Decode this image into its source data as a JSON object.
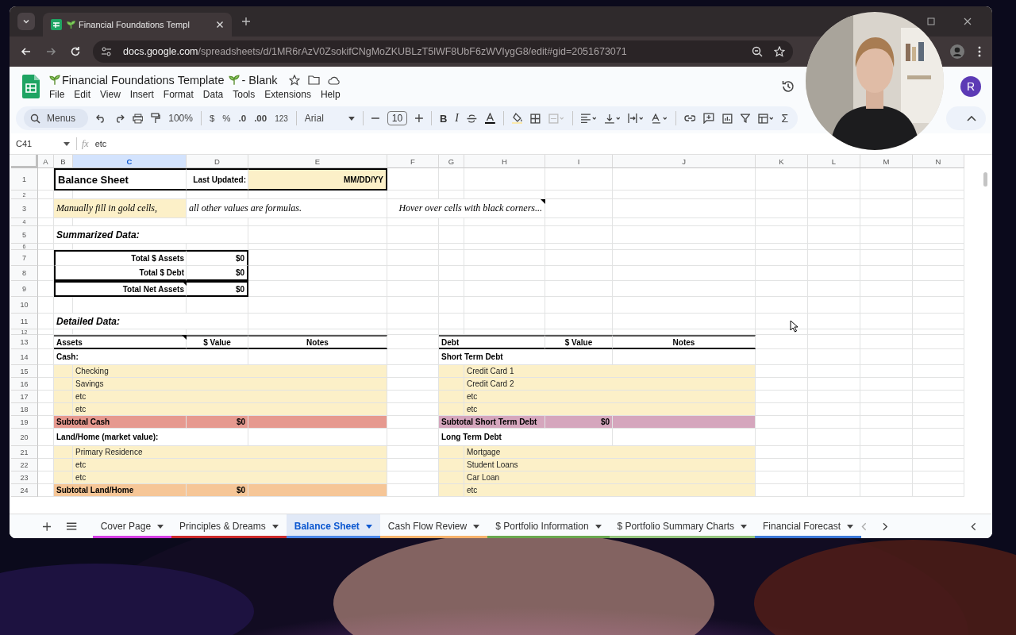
{
  "browser": {
    "tab_title": "Financial Foundations Templ",
    "url_host": "docs.google.com",
    "url_path": "/spreadsheets/d/1MR6rAzV0ZsokifCNgMoZKUBLzT5lWF8UbF6zWVIygG8/edit#gid=2051673071"
  },
  "doc": {
    "title": "Financial Foundations Template",
    "suffix": "- Blank",
    "menus": [
      "File",
      "Edit",
      "View",
      "Insert",
      "Format",
      "Data",
      "Tools",
      "Extensions",
      "Help"
    ],
    "avatar": "R"
  },
  "toolbar": {
    "search": "Menus",
    "zoom": "100%",
    "currency": "$",
    "percent": "%",
    "dec_less": ".0",
    "dec_more": ".00",
    "number_format": "123",
    "font": "Arial",
    "font_size": "10",
    "bold": "B",
    "italic": "I",
    "sum": "Σ"
  },
  "formula_bar": {
    "cell": "C41",
    "fx": "fx",
    "value": "etc"
  },
  "sheet": {
    "columns": [
      {
        "label": "A",
        "selected": false
      },
      {
        "label": "B",
        "selected": false
      },
      {
        "label": "C",
        "selected": true
      },
      {
        "label": "D",
        "selected": false
      },
      {
        "label": "E",
        "selected": false
      },
      {
        "label": "F",
        "selected": false
      },
      {
        "label": "G",
        "selected": false
      },
      {
        "label": "H",
        "selected": false
      },
      {
        "label": "I",
        "selected": false
      },
      {
        "label": "J",
        "selected": false
      },
      {
        "label": "K",
        "selected": false
      },
      {
        "label": "L",
        "selected": false
      },
      {
        "label": "M",
        "selected": false
      },
      {
        "label": "N",
        "selected": false
      }
    ],
    "rows": [
      {
        "number": "1",
        "kind": "boxed",
        "cells": [
          "",
          {
            "text": "Balance Sheet",
            "kind": "title"
          },
          "",
          {
            "text": "Last Updated:",
            "kind": "label"
          },
          {
            "text": "MM/DD/YY",
            "kind": "amount",
            "color": "#fcf0c8"
          }
        ]
      },
      {
        "number": "2",
        "cells": []
      },
      {
        "number": "3",
        "cells": [
          "",
          {
            "text": "Manually fill in gold cells,",
            "kind": "script",
            "color": "#fcf0c8"
          },
          {
            "color": "#fcf0c8"
          },
          {
            "text": "all other values are formulas.",
            "kind": "script"
          },
          "",
          "",
          "",
          {
            "text": "Hover over cells with black corners...",
            "kind": "hint",
            "note": true
          }
        ]
      },
      {
        "number": "4",
        "cells": []
      },
      {
        "number": "5",
        "cells": [
          "",
          {
            "text": "Summarized Data:",
            "kind": "heading"
          }
        ]
      },
      {
        "number": "6",
        "cells": []
      },
      {
        "number": "7",
        "kind": "boxtop",
        "cells": [
          "",
          "",
          {
            "text": "Total $ Assets",
            "kind": "label"
          },
          {
            "text": "$0",
            "kind": "amount"
          }
        ]
      },
      {
        "number": "8",
        "kind": "boxbottom",
        "cells": [
          "",
          "",
          {
            "text": "Total $ Debt",
            "kind": "label"
          },
          {
            "text": "$0",
            "kind": "amount"
          }
        ]
      },
      {
        "number": "9",
        "kind": "boxed",
        "cells": [
          "",
          "",
          {
            "text": "Total Net Assets",
            "kind": "label",
            "note": true
          },
          {
            "text": "$0",
            "kind": "amount"
          }
        ]
      },
      {
        "number": "10",
        "cells": []
      },
      {
        "number": "11",
        "cells": [
          "",
          {
            "text": "Detailed Data:",
            "kind": "heading"
          }
        ]
      },
      {
        "number": "12",
        "cells": []
      },
      {
        "number": "13",
        "kind": "ruled",
        "cells": [
          "",
          {
            "text": "Assets",
            "kind": "bold",
            "note": true
          },
          "",
          {
            "text": "$ Value",
            "kind": "header"
          },
          {
            "text": "Notes",
            "kind": "header"
          },
          "",
          {
            "text": "Debt",
            "kind": "bold"
          },
          "",
          {
            "text": "$ Value",
            "kind": "header"
          },
          {
            "text": "Notes",
            "kind": "header"
          }
        ]
      },
      {
        "number": "14",
        "cells": [
          "",
          {
            "text": "Cash:",
            "kind": "bold"
          },
          "",
          "",
          "",
          "",
          {
            "text": "Short Term Debt",
            "kind": "bold"
          }
        ]
      },
      {
        "number": "15",
        "cells": [
          "",
          {
            "color": "#fcf0c8"
          },
          {
            "text": "Checking",
            "kind": "plain",
            "color": "#fcf0c8"
          },
          {
            "color": "#fcf0c8"
          },
          {
            "color": "#fcf0c8"
          },
          "",
          {
            "color": "#fcf0c8"
          },
          {
            "text": "Credit Card 1",
            "kind": "plain",
            "color": "#fcf0c8"
          },
          {
            "color": "#fcf0c8"
          },
          {
            "color": "#fcf0c8"
          }
        ]
      },
      {
        "number": "16",
        "cells": [
          "",
          {
            "color": "#fcf0c8"
          },
          {
            "text": "Savings",
            "kind": "plain",
            "color": "#fcf0c8"
          },
          {
            "color": "#fcf0c8"
          },
          {
            "color": "#fcf0c8"
          },
          "",
          {
            "color": "#fcf0c8"
          },
          {
            "text": "Credit Card 2",
            "kind": "plain",
            "color": "#fcf0c8"
          },
          {
            "color": "#fcf0c8"
          },
          {
            "color": "#fcf0c8"
          }
        ]
      },
      {
        "number": "17",
        "cells": [
          "",
          {
            "color": "#fcf0c8"
          },
          {
            "text": "etc",
            "kind": "plain",
            "color": "#fcf0c8"
          },
          {
            "color": "#fcf0c8"
          },
          {
            "color": "#fcf0c8"
          },
          "",
          {
            "color": "#fcf0c8"
          },
          {
            "text": "etc",
            "kind": "plain",
            "color": "#fcf0c8"
          },
          {
            "color": "#fcf0c8"
          },
          {
            "color": "#fcf0c8"
          }
        ]
      },
      {
        "number": "18",
        "cells": [
          "",
          {
            "color": "#fcf0c8"
          },
          {
            "text": "etc",
            "kind": "plain",
            "color": "#fcf0c8"
          },
          {
            "color": "#fcf0c8"
          },
          {
            "color": "#fcf0c8"
          },
          "",
          {
            "color": "#fcf0c8"
          },
          {
            "text": "etc",
            "kind": "plain",
            "color": "#fcf0c8"
          },
          {
            "color": "#fcf0c8"
          },
          {
            "color": "#fcf0c8"
          }
        ]
      },
      {
        "number": "19",
        "cells": [
          "",
          {
            "text": "Subtotal Cash",
            "kind": "bold",
            "color": "#e6998f"
          },
          {
            "color": "#e6998f"
          },
          {
            "text": "$0",
            "kind": "amount",
            "color": "#e6998f"
          },
          {
            "color": "#e6998f"
          },
          "",
          {
            "text": "Subtotal Short Term Debt",
            "kind": "bold",
            "color": "#d5a6bd"
          },
          {
            "color": "#d5a6bd"
          },
          {
            "text": "$0",
            "kind": "amount",
            "color": "#d5a6bd"
          },
          {
            "color": "#d5a6bd"
          }
        ]
      },
      {
        "number": "20",
        "cells": [
          "",
          {
            "text": "Land/Home (market value):",
            "kind": "bold"
          },
          "",
          "",
          "",
          "",
          {
            "text": "Long Term Debt",
            "kind": "bold"
          }
        ]
      },
      {
        "number": "21",
        "cells": [
          "",
          {
            "color": "#fcf0c8"
          },
          {
            "text": "Primary Residence",
            "kind": "plain",
            "color": "#fcf0c8"
          },
          {
            "color": "#fcf0c8"
          },
          {
            "color": "#fcf0c8"
          },
          "",
          {
            "color": "#fcf0c8"
          },
          {
            "text": "Mortgage",
            "kind": "plain",
            "color": "#fcf0c8"
          },
          {
            "color": "#fcf0c8"
          },
          {
            "color": "#fcf0c8"
          }
        ]
      },
      {
        "number": "22",
        "cells": [
          "",
          {
            "color": "#fcf0c8"
          },
          {
            "text": "etc",
            "kind": "plain",
            "color": "#fcf0c8"
          },
          {
            "color": "#fcf0c8"
          },
          {
            "color": "#fcf0c8"
          },
          "",
          {
            "color": "#fcf0c8"
          },
          {
            "text": "Student Loans",
            "kind": "plain",
            "color": "#fcf0c8"
          },
          {
            "color": "#fcf0c8"
          },
          {
            "color": "#fcf0c8"
          }
        ]
      },
      {
        "number": "23",
        "cells": [
          "",
          {
            "color": "#fcf0c8"
          },
          {
            "text": "etc",
            "kind": "plain",
            "color": "#fcf0c8"
          },
          {
            "color": "#fcf0c8"
          },
          {
            "color": "#fcf0c8"
          },
          "",
          {
            "color": "#fcf0c8"
          },
          {
            "text": "Car Loan",
            "kind": "plain",
            "color": "#fcf0c8"
          },
          {
            "color": "#fcf0c8"
          },
          {
            "color": "#fcf0c8"
          }
        ]
      },
      {
        "number": "24",
        "cells": [
          "",
          {
            "text": "Subtotal Land/Home",
            "kind": "bold",
            "color": "#f6c697"
          },
          {
            "color": "#f6c697"
          },
          {
            "text": "$0",
            "kind": "amount",
            "color": "#f6c697"
          },
          {
            "color": "#f6c697"
          },
          "",
          {
            "color": "#fcf0c8"
          },
          {
            "text": "etc",
            "kind": "plain",
            "color": "#fcf0c8"
          },
          {
            "color": "#fcf0c8"
          },
          {
            "color": "#fcf0c8"
          }
        ]
      }
    ]
  },
  "sheet_tabs": [
    {
      "label": "Cover Page",
      "selected": false,
      "color": "#d53fe6"
    },
    {
      "label": "Principles & Dreams",
      "selected": false,
      "color": "#cc2a2a"
    },
    {
      "label": "Balance Sheet",
      "selected": true,
      "color": "#4a86e8"
    },
    {
      "label": "Cash Flow Review",
      "selected": false,
      "color": "#f6b26b"
    },
    {
      "label": "$ Portfolio Information",
      "selected": false,
      "color": "#6aa84f"
    },
    {
      "label": "$ Portfolio Summary Charts",
      "selected": false,
      "color": "#93c47d"
    },
    {
      "label": "Financial Forecast",
      "selected": false,
      "color": "#3c78d8"
    }
  ]
}
